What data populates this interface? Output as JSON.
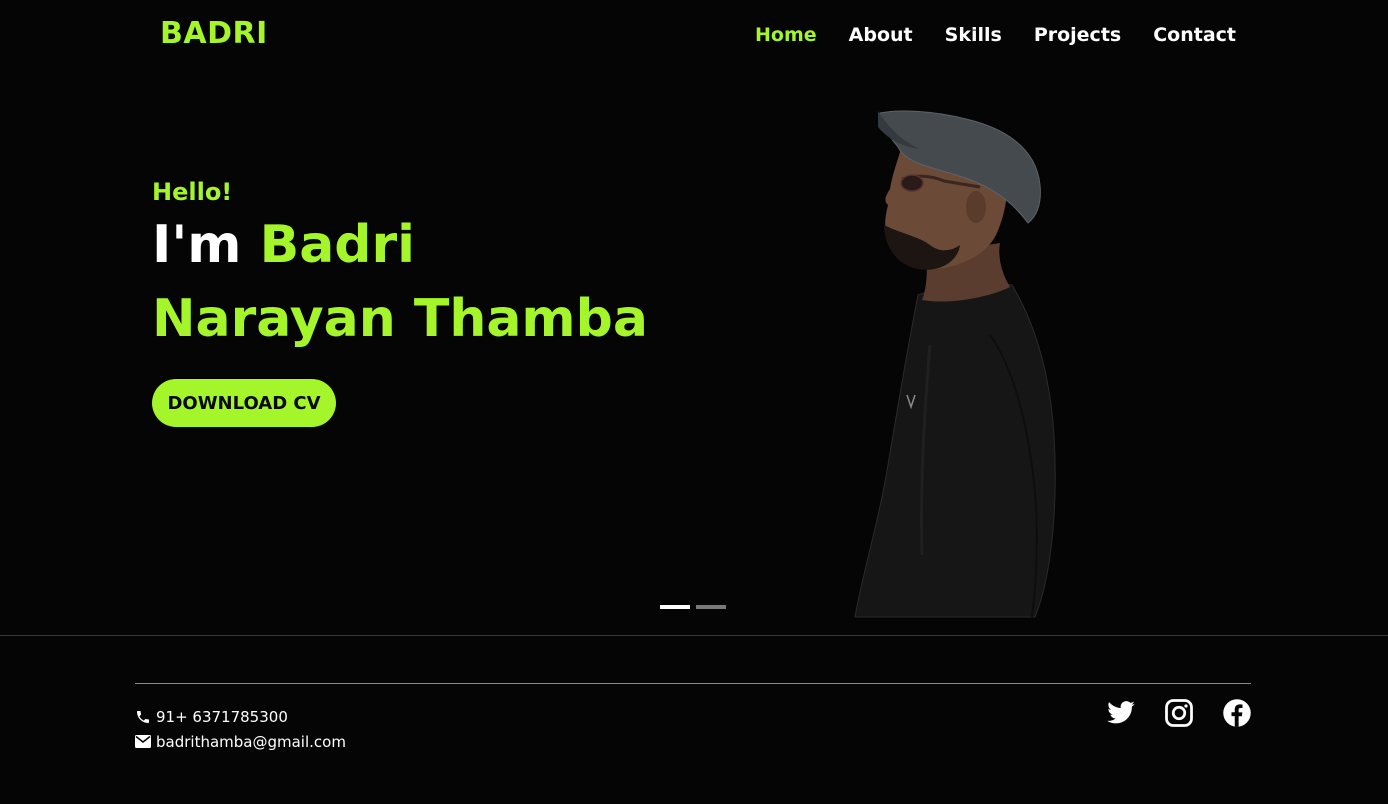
{
  "header": {
    "brand": "BADRI",
    "nav": [
      {
        "label": "Home",
        "active": true
      },
      {
        "label": "About",
        "active": false
      },
      {
        "label": "Skills",
        "active": false
      },
      {
        "label": "Projects",
        "active": false
      },
      {
        "label": "Contact",
        "active": false
      }
    ]
  },
  "hero": {
    "greeting": "Hello!",
    "intro_prefix": "I'm ",
    "first_name": "Badri",
    "rest_name": "Narayan Thamba",
    "cta_label": "DOWNLOAD CV",
    "slides": [
      {
        "active": true
      },
      {
        "active": false
      }
    ]
  },
  "footer": {
    "phone": "91+ 6371785300",
    "email": "badrithamba@gmail.com",
    "social": [
      "twitter-icon",
      "instagram-icon",
      "facebook-icon"
    ]
  },
  "colors": {
    "accent": "#a5f52b",
    "background": "#050505",
    "text": "#ffffff"
  }
}
